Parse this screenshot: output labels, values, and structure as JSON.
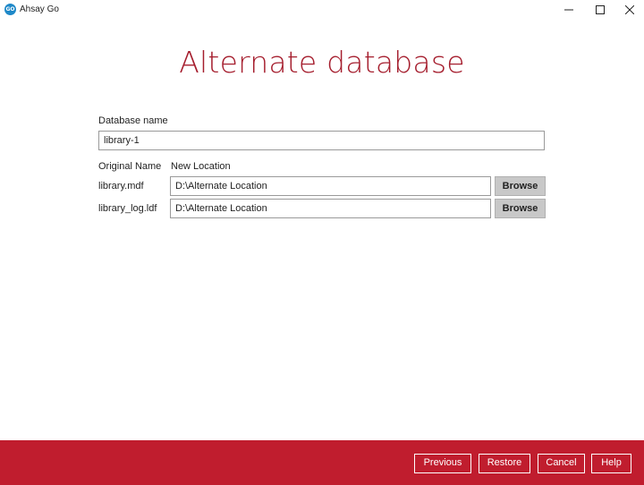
{
  "window": {
    "icon_text": "GO",
    "title": "Ahsay Go"
  },
  "page": {
    "heading": "Alternate database"
  },
  "form": {
    "db_name_label": "Database name",
    "db_name_value": "library-1",
    "col_original": "Original Name",
    "col_new_location": "New Location",
    "rows": [
      {
        "original": "library.mdf",
        "location": "D:\\Alternate Location",
        "browse_label": "Browse"
      },
      {
        "original": "library_log.ldf",
        "location": "D:\\Alternate Location",
        "browse_label": "Browse"
      }
    ]
  },
  "footer": {
    "previous": "Previous",
    "restore": "Restore",
    "cancel": "Cancel",
    "help": "Help"
  },
  "colors": {
    "accent": "#a51d2d",
    "footer_bg": "#c01d2e",
    "app_icon": "#1e88c8"
  },
  "icons": [
    "app-logo-icon",
    "minimize-icon",
    "maximize-icon",
    "close-icon"
  ]
}
